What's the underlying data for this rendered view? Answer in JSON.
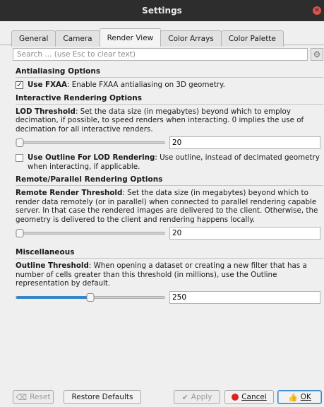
{
  "window": {
    "title": "Settings"
  },
  "tabs": [
    {
      "label": "General"
    },
    {
      "label": "Camera"
    },
    {
      "label": "Render View"
    },
    {
      "label": "Color Arrays"
    },
    {
      "label": "Color Palette"
    }
  ],
  "search": {
    "placeholder": "Search ... (use Esc to clear text)"
  },
  "antialiasing": {
    "header": "Antialiasing Options",
    "fxaa_label": "Use FXAA",
    "fxaa_desc": ": Enable FXAA antialiasing on 3D geometry.",
    "fxaa_checked": true
  },
  "interactive": {
    "header": "Interactive Rendering Options",
    "lod_label": "LOD Threshold",
    "lod_desc": ": Set the data size (in megabytes) beyond which to employ decimation, if possible, to speed renders when interacting. 0 implies the use of decimation for all interactive renders.",
    "lod_value": "20",
    "lod_fraction": 0.0,
    "outline_label": "Use Outline For LOD Rendering",
    "outline_desc": ": Use outline, instead of decimated geometry when interacting, if applicable.",
    "outline_checked": false
  },
  "remote": {
    "header": "Remote/Parallel Rendering Options",
    "label": "Remote Render Threshold",
    "desc": ": Set the data size (in megabytes) beyond which to render data remotely (or in parallel) when connected to parallel rendering capable server. In that case the rendered images are delivered to the client. Otherwise, the geometry is delivered to the client and rendering happens locally.",
    "value": "20",
    "fraction": 0.0
  },
  "misc": {
    "header": "Miscellaneous",
    "label": "Outline Threshold",
    "desc": ": When opening a dataset or creating a new filter that has a number of cells greater than this threshold (in millions), use the Outline representation by default.",
    "value": "250",
    "fraction": 0.5
  },
  "buttons": {
    "reset": "Reset",
    "restore": "Restore Defaults",
    "apply": "Apply",
    "cancel": "Cancel",
    "ok": "OK"
  }
}
